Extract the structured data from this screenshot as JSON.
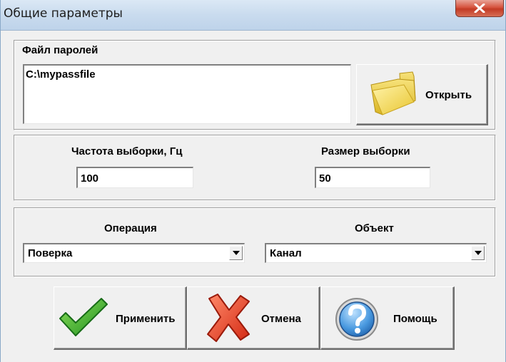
{
  "window": {
    "title": "Общие параметры"
  },
  "password_file": {
    "group_label": "Файл паролей",
    "value": "C:\\mypassfile",
    "open_button_label": "Открыть"
  },
  "sampling": {
    "frequency_label": "Частота выборки, Гц",
    "frequency_value": "100",
    "size_label": "Размер выборки",
    "size_value": "50"
  },
  "operation": {
    "label": "Операция",
    "selected": "Поверка"
  },
  "object": {
    "label": "Объект",
    "selected": "Канал"
  },
  "buttons": {
    "apply": "Применить",
    "cancel": "Отмена",
    "help": "Помощь"
  },
  "icons": {
    "close": "close-icon",
    "folder": "folder-icon",
    "apply": "checkmark-icon",
    "cancel": "red-x-icon",
    "help": "question-mark-icon"
  }
}
